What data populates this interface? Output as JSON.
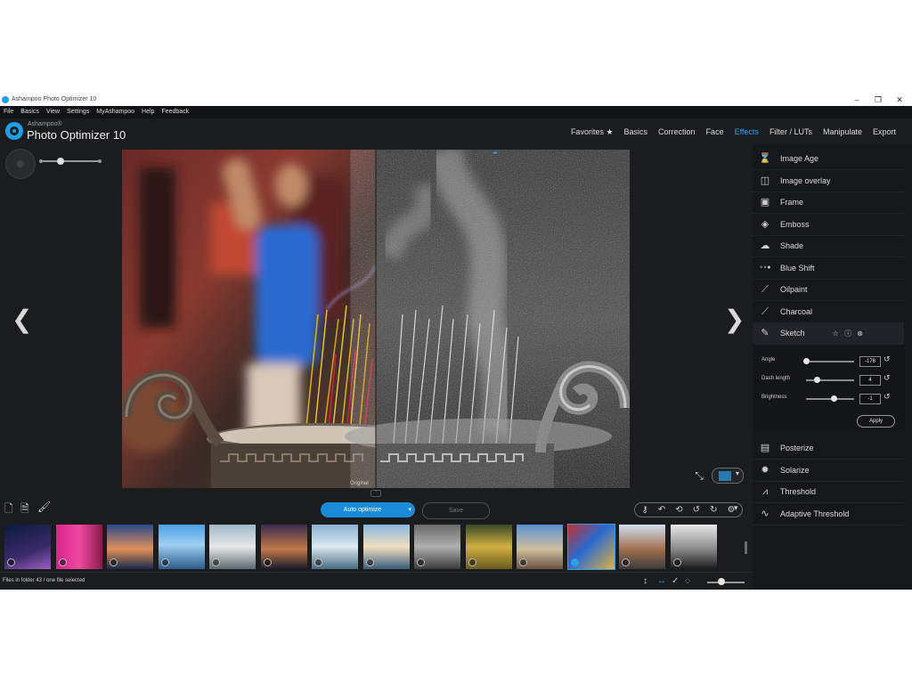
{
  "window": {
    "title": "Ashampoo Photo Optimizer 10"
  },
  "menu": [
    "File",
    "Basics",
    "View",
    "Settings",
    "MyAshampoo",
    "Help",
    "Feedback"
  ],
  "brand": {
    "small": "Ashampoo®",
    "big": "Photo Optimizer 10"
  },
  "tabs": [
    {
      "label": "Favorites ★",
      "active": false
    },
    {
      "label": "Basics",
      "active": false
    },
    {
      "label": "Correction",
      "active": false
    },
    {
      "label": "Face",
      "active": false
    },
    {
      "label": "Effects",
      "active": true
    },
    {
      "label": "Filter / LUTs",
      "active": false
    },
    {
      "label": "Manipulate",
      "active": false
    },
    {
      "label": "Export",
      "active": false
    }
  ],
  "viewer": {
    "original_label": "Original",
    "zoom_level": 0.35
  },
  "effects_top": [
    {
      "label": "Image Age",
      "icon": "hourglass-icon",
      "glyph": "⌛"
    },
    {
      "label": "Image overlay",
      "icon": "image-overlay-icon",
      "glyph": "◫"
    },
    {
      "label": "Frame",
      "icon": "frame-icon",
      "glyph": "▣"
    },
    {
      "label": "Emboss",
      "icon": "emboss-icon",
      "glyph": "◈"
    },
    {
      "label": "Shade",
      "icon": "cloud-icon",
      "glyph": "☁"
    },
    {
      "label": "Blue Shift",
      "icon": "dots-icon",
      "glyph": "∘∘●"
    },
    {
      "label": "Oilpaint",
      "icon": "brush-icon",
      "glyph": "⟋"
    },
    {
      "label": "Charcoal",
      "icon": "pencil-icon",
      "glyph": "⟋"
    },
    {
      "label": "Sketch",
      "icon": "pen-icon",
      "glyph": "✎"
    }
  ],
  "sketch": {
    "extra_icons": "☆ ⓘ ⊗",
    "params": [
      {
        "label": "Angle",
        "value": "-178",
        "position": 0.0
      },
      {
        "label": "Dash length",
        "value": "4",
        "position": 0.22
      },
      {
        "label": "Brightness",
        "value": "-1",
        "position": 0.58
      }
    ],
    "apply_label": "Apply"
  },
  "effects_bottom": [
    {
      "label": "Posterize",
      "icon": "posterize-icon",
      "glyph": "▤"
    },
    {
      "label": "Solarize",
      "icon": "sun-icon",
      "glyph": "✹"
    },
    {
      "label": "Threshold",
      "icon": "threshold-icon",
      "glyph": "⩘"
    },
    {
      "label": "Adaptive Threshold",
      "icon": "adaptive-threshold-icon",
      "glyph": "∿"
    }
  ],
  "toolbar": {
    "auto_optimize": "Auto optimize",
    "save": "Save"
  },
  "status": {
    "text": "Files in folder 43 / one file selected"
  },
  "thumbnails": [
    {
      "name": "thumb-city-night",
      "bg": "linear-gradient(160deg,#0b1a3a,#3a2a6a 60%,#9a60c0)"
    },
    {
      "name": "thumb-pink-door",
      "bg": "linear-gradient(90deg,#d8238a,#f04aa0 50%,#8a1a4a)"
    },
    {
      "name": "thumb-sunset-sea",
      "bg": "linear-gradient(180deg,#2a4a8a,#e0905a 55%,#1a2a4a)"
    },
    {
      "name": "thumb-mountain-lake",
      "bg": "linear-gradient(180deg,#4aa0e8,#a0d0f0 45%,#2a5a8a)"
    },
    {
      "name": "thumb-rocky-coast",
      "bg": "linear-gradient(180deg,#a0b8c8,#e8e8e8 50%,#5a6a70)"
    },
    {
      "name": "thumb-city-dusk",
      "bg": "linear-gradient(180deg,#3a2a4a,#c07a4a 55%,#1a1a2a)"
    },
    {
      "name": "thumb-skyline-water",
      "bg": "linear-gradient(180deg,#8ab0d0,#dce8f0 50%,#4a6a80)"
    },
    {
      "name": "thumb-castle-reflection",
      "bg": "linear-gradient(180deg,#8ab8e0,#f0e0c0 50%,#3a5a7a)"
    },
    {
      "name": "thumb-stone-face",
      "bg": "linear-gradient(180deg,#6a6a6a,#b0b0b0 50%,#3a3a3a)"
    },
    {
      "name": "thumb-golden-buddha",
      "bg": "linear-gradient(180deg,#3a4a2a,#d0b040 50%,#6a5a20)"
    },
    {
      "name": "thumb-village-street",
      "bg": "linear-gradient(180deg,#5a90d0,#d0c0a0 55%,#6a5040)"
    },
    {
      "name": "thumb-incense-praying",
      "bg": "linear-gradient(135deg,#c03030,#2a6ad0 45%,#e0b040)",
      "selected": true
    },
    {
      "name": "thumb-arch-view",
      "bg": "linear-gradient(180deg,#d0e0f0,#a07050 55%,#3a3a3a)"
    },
    {
      "name": "thumb-gondolas-bw",
      "bg": "linear-gradient(180deg,#e8e8e8,#8a8a8a 55%,#1a1a1a)"
    }
  ]
}
